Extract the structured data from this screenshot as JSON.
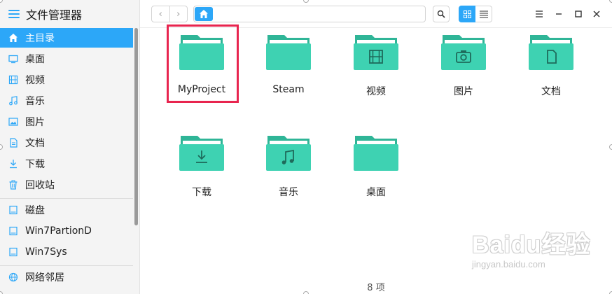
{
  "app": {
    "title": "文件管理器"
  },
  "sidebar": {
    "items": [
      {
        "label": "主目录",
        "icon": "home-icon",
        "active": true
      },
      {
        "label": "桌面",
        "icon": "desktop-icon"
      },
      {
        "label": "视频",
        "icon": "video-icon"
      },
      {
        "label": "音乐",
        "icon": "music-icon"
      },
      {
        "label": "图片",
        "icon": "picture-icon"
      },
      {
        "label": "文档",
        "icon": "document-icon"
      },
      {
        "label": "下载",
        "icon": "download-icon"
      },
      {
        "label": "回收站",
        "icon": "trash-icon"
      },
      {
        "label": "磁盘",
        "icon": "disk-icon"
      },
      {
        "label": "Win7PartionD",
        "icon": "disk-icon"
      },
      {
        "label": "Win7Sys",
        "icon": "disk-icon"
      },
      {
        "label": "网络邻居",
        "icon": "network-icon"
      }
    ]
  },
  "toolbar": {
    "back": "‹",
    "forward": "›",
    "address_home_icon": "home-icon",
    "search_icon": "search-icon",
    "views": [
      "icon-view",
      "list-view"
    ],
    "active_view": "icon-view",
    "window_buttons": [
      "menu-icon",
      "minimize-icon",
      "maximize-icon",
      "close-icon"
    ]
  },
  "files": [
    {
      "label": "MyProject",
      "icon": "folder-icon",
      "selected": true
    },
    {
      "label": "Steam",
      "icon": "folder-icon"
    },
    {
      "label": "视频",
      "icon": "video-folder-icon"
    },
    {
      "label": "图片",
      "icon": "picture-folder-icon"
    },
    {
      "label": "文档",
      "icon": "document-folder-icon"
    },
    {
      "label": "下载",
      "icon": "download-folder-icon"
    },
    {
      "label": "音乐",
      "icon": "music-folder-icon"
    },
    {
      "label": "桌面",
      "icon": "desktop-folder-icon"
    }
  ],
  "status": {
    "count": "8 项"
  },
  "watermark": {
    "brand": "Baidu经验",
    "url": "jingyan.baidu.com"
  },
  "colors": {
    "accent": "#2ca7f8",
    "folder": "#3ed2b2",
    "folder_dark": "#2fb597",
    "selection": "#e8254f"
  }
}
